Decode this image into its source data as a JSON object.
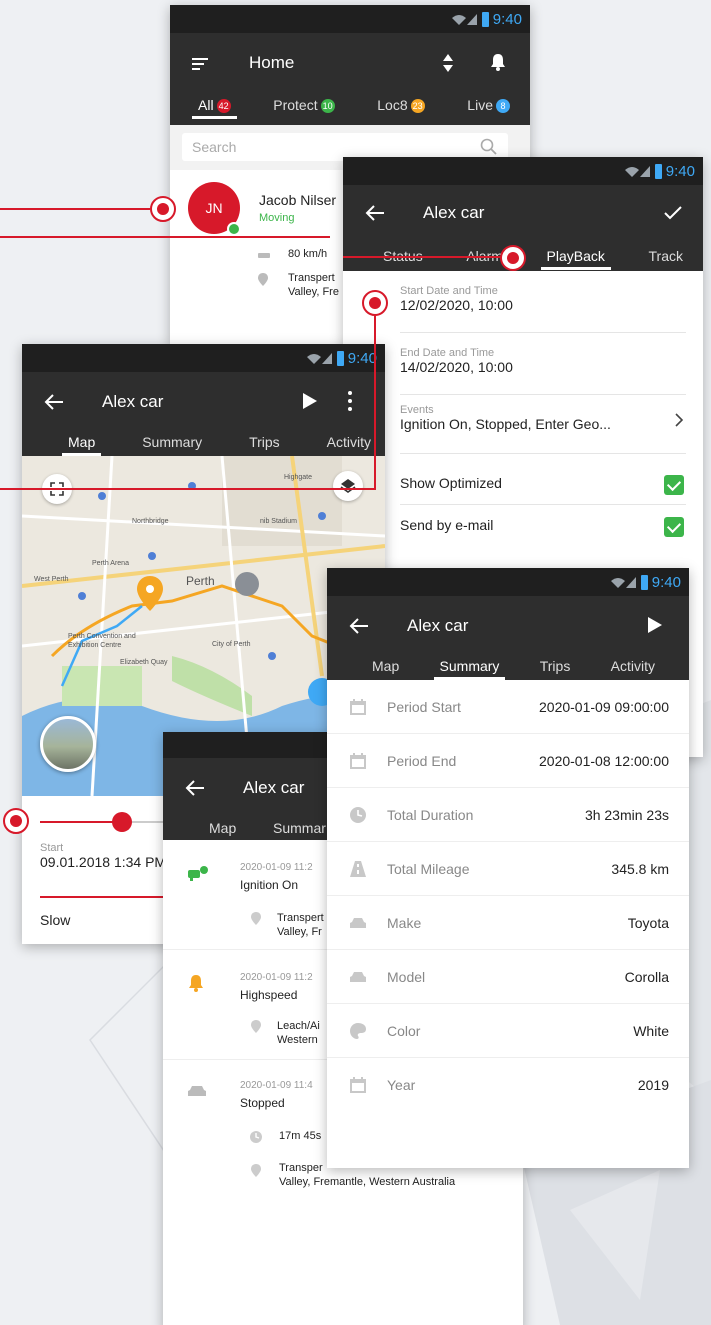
{
  "status_time": "9:40",
  "colors": {
    "accent": "#d7192a",
    "appbar": "#2e2e2e",
    "statusbar": "#1f1f1f",
    "online": "#3cb54a",
    "route": "#f5a623"
  },
  "home": {
    "title": "Home",
    "tabs": [
      {
        "label": "All",
        "count": "42",
        "color": "#d7192a"
      },
      {
        "label": "Protect",
        "count": "10",
        "color": "#3cb54a"
      },
      {
        "label": "Loc8",
        "count": "23",
        "color": "#f5a623"
      },
      {
        "label": "Live",
        "count": "8",
        "color": "#3fa9f5"
      }
    ],
    "search_placeholder": "Search",
    "contact": {
      "initials": "JN",
      "name": "Jacob Nilser",
      "status": "Moving",
      "speed": "80 km/h",
      "address_1": "Transpert",
      "address_2": "Valley, Fre"
    }
  },
  "playback_screen": {
    "title": "Alex car",
    "tabs": [
      "Status",
      "Alarm",
      "PlayBack",
      "Track"
    ],
    "start_label": "Start Date and Time",
    "start_value": "12/02/2020, 10:00",
    "end_label": "End Date and Time",
    "end_value": "14/02/2020, 10:00",
    "events_label": "Events",
    "events_value": "Ignition On, Stopped, Enter Geo...",
    "show_optimized": "Show Optimized",
    "send_email": "Send by e-mail"
  },
  "map_screen": {
    "title": "Alex car",
    "tabs": [
      "Map",
      "Summary",
      "Trips",
      "Activity"
    ],
    "places": [
      "Perth",
      "Perth Convention and Exhibition Centre",
      "City of Perth",
      "Elizabeth Quay",
      "West Perth",
      "Northbridge",
      "nib Stadium",
      "Perth Arena",
      "Highgate"
    ],
    "start_label": "Start",
    "start_value": "09.01.2018 1:34 PM",
    "speed_label": "Slow"
  },
  "summary_screen": {
    "title": "Alex car",
    "tabs": [
      "Map",
      "Summary",
      "Trips",
      "Activity"
    ],
    "rows": [
      {
        "label": "Period Start",
        "value": "2020-01-09 09:00:00",
        "icon": "calendar-icon"
      },
      {
        "label": "Period End",
        "value": "2020-01-08 12:00:00",
        "icon": "calendar-icon"
      },
      {
        "label": "Total Duration",
        "value": "3h 23min 23s",
        "icon": "clock-icon"
      },
      {
        "label": "Total Mileage",
        "value": "345.8 km",
        "icon": "road-icon"
      },
      {
        "label": "Make",
        "value": "Toyota",
        "icon": "car-icon"
      },
      {
        "label": "Model",
        "value": "Corolla",
        "icon": "car-icon"
      },
      {
        "label": "Color",
        "value": "White",
        "icon": "palette-icon"
      },
      {
        "label": "Year",
        "value": "2019",
        "icon": "calendar-icon"
      }
    ]
  },
  "activity_screen": {
    "title": "Alex car",
    "tabs": [
      "Map",
      "Summar"
    ],
    "events": [
      {
        "time": "2020-01-09 11:2",
        "name": "Ignition On",
        "addr1": "Transpert",
        "addr2": "Valley, Fr"
      },
      {
        "time": "2020-01-09 11:2",
        "name": "Highspeed",
        "addr1": "Leach/Ai",
        "addr2": "Western"
      },
      {
        "time": "2020-01-09 11:4",
        "name": "Stopped",
        "duration": "17m 45s",
        "addr1": "Transper",
        "addr2": "Valley, Fremantle, Western Australia"
      }
    ]
  }
}
